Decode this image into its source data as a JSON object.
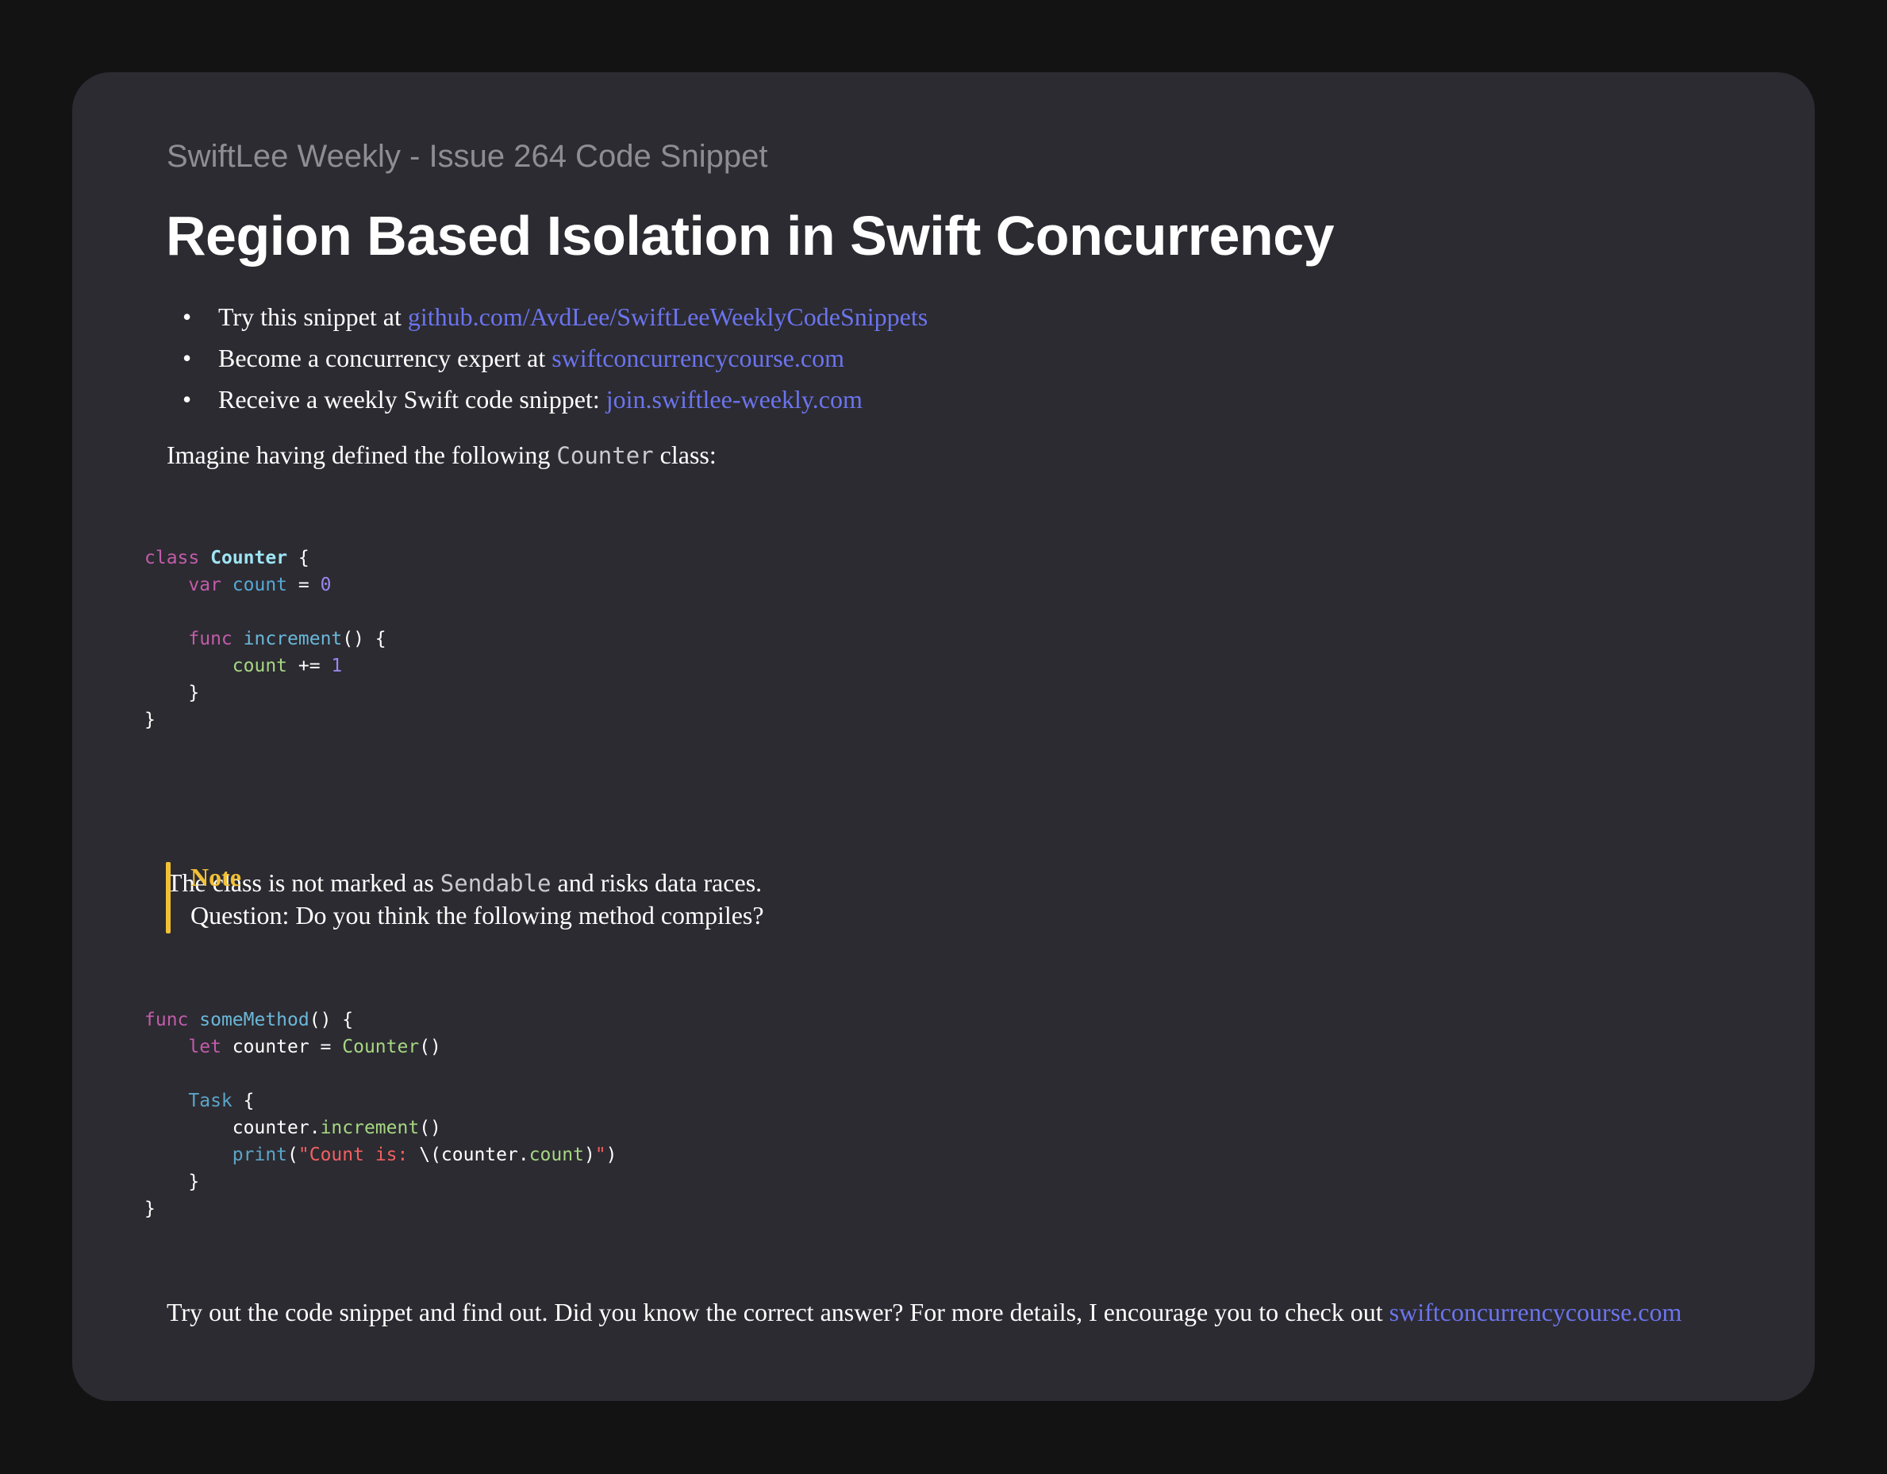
{
  "header": {
    "subtitle": "SwiftLee Weekly - Issue 264 Code Snippet",
    "title": "Region Based Isolation in Swift Concurrency"
  },
  "bullets": [
    {
      "text": "Try this snippet at ",
      "link": "github.com/AvdLee/SwiftLeeWeeklyCodeSnippets"
    },
    {
      "text": "Become a concurrency expert at ",
      "link": "swiftconcurrencycourse.com"
    },
    {
      "text": "Receive a weekly Swift code snippet: ",
      "link": "join.swiftlee-weekly.com"
    }
  ],
  "intro": {
    "before": "Imagine having defined the following ",
    "code": "Counter",
    "after": " class:"
  },
  "code1": [
    [
      [
        "class",
        "kw"
      ],
      [
        " ",
        "p"
      ],
      [
        "Counter",
        "typedecl"
      ],
      [
        " {",
        "p"
      ]
    ],
    [
      [
        "    ",
        "p"
      ],
      [
        "var",
        "kw"
      ],
      [
        " ",
        "p"
      ],
      [
        "count",
        "id"
      ],
      [
        " = ",
        "p"
      ],
      [
        "0",
        "num"
      ]
    ],
    [],
    [
      [
        "    ",
        "p"
      ],
      [
        "func",
        "kw"
      ],
      [
        " ",
        "p"
      ],
      [
        "increment",
        "fn"
      ],
      [
        "() {",
        "p"
      ]
    ],
    [
      [
        "        ",
        "p"
      ],
      [
        "count",
        "prop"
      ],
      [
        " += ",
        "p"
      ],
      [
        "1",
        "num"
      ]
    ],
    [
      [
        "    }",
        "p"
      ]
    ],
    [
      [
        "}",
        "p"
      ]
    ]
  ],
  "sendable": {
    "before": "The class is not marked as ",
    "code": "Sendable",
    "after": " and risks data races."
  },
  "note": {
    "title": "Note",
    "body": "Question: Do you think the following method compiles?"
  },
  "code2": [
    [
      [
        "func",
        "kw"
      ],
      [
        " ",
        "p"
      ],
      [
        "someMethod",
        "fn"
      ],
      [
        "() {",
        "p"
      ]
    ],
    [
      [
        "    ",
        "p"
      ],
      [
        "let",
        "kw"
      ],
      [
        " counter = ",
        "p"
      ],
      [
        "Counter",
        "call"
      ],
      [
        "()",
        "p"
      ]
    ],
    [],
    [
      [
        "    ",
        "p"
      ],
      [
        "Task",
        "type"
      ],
      [
        " {",
        "p"
      ]
    ],
    [
      [
        "        counter.",
        "p"
      ],
      [
        "increment",
        "call"
      ],
      [
        "()",
        "p"
      ]
    ],
    [
      [
        "        ",
        "p"
      ],
      [
        "print",
        "type"
      ],
      [
        "(",
        "p"
      ],
      [
        "\"Count is: ",
        "str"
      ],
      [
        "\\(counter.",
        "p"
      ],
      [
        "count",
        "call"
      ],
      [
        ")",
        "p"
      ],
      [
        "\"",
        "str"
      ],
      [
        ")",
        "p"
      ]
    ],
    [
      [
        "    }",
        "p"
      ]
    ],
    [
      [
        "}",
        "p"
      ]
    ]
  ],
  "footer": {
    "text": "Try out the code snippet and find out. Did you know the correct answer? For more details, I encourage you to check out ",
    "link": "swiftconcurrencycourse.com"
  },
  "colors": {
    "card": "#2c2b31",
    "background": "#131314",
    "link": "#6b74ee",
    "note_accent": "#f2c036",
    "kw": "#c25cab",
    "typedecl": "#9ee5f5",
    "id": "#56a8d6",
    "fn": "#6ab7d9",
    "type": "#5ba6c9",
    "prop": "#a6d782",
    "call": "#a6d782",
    "num": "#9a86f0",
    "str": "#f25f60",
    "p": "#ffffff"
  }
}
